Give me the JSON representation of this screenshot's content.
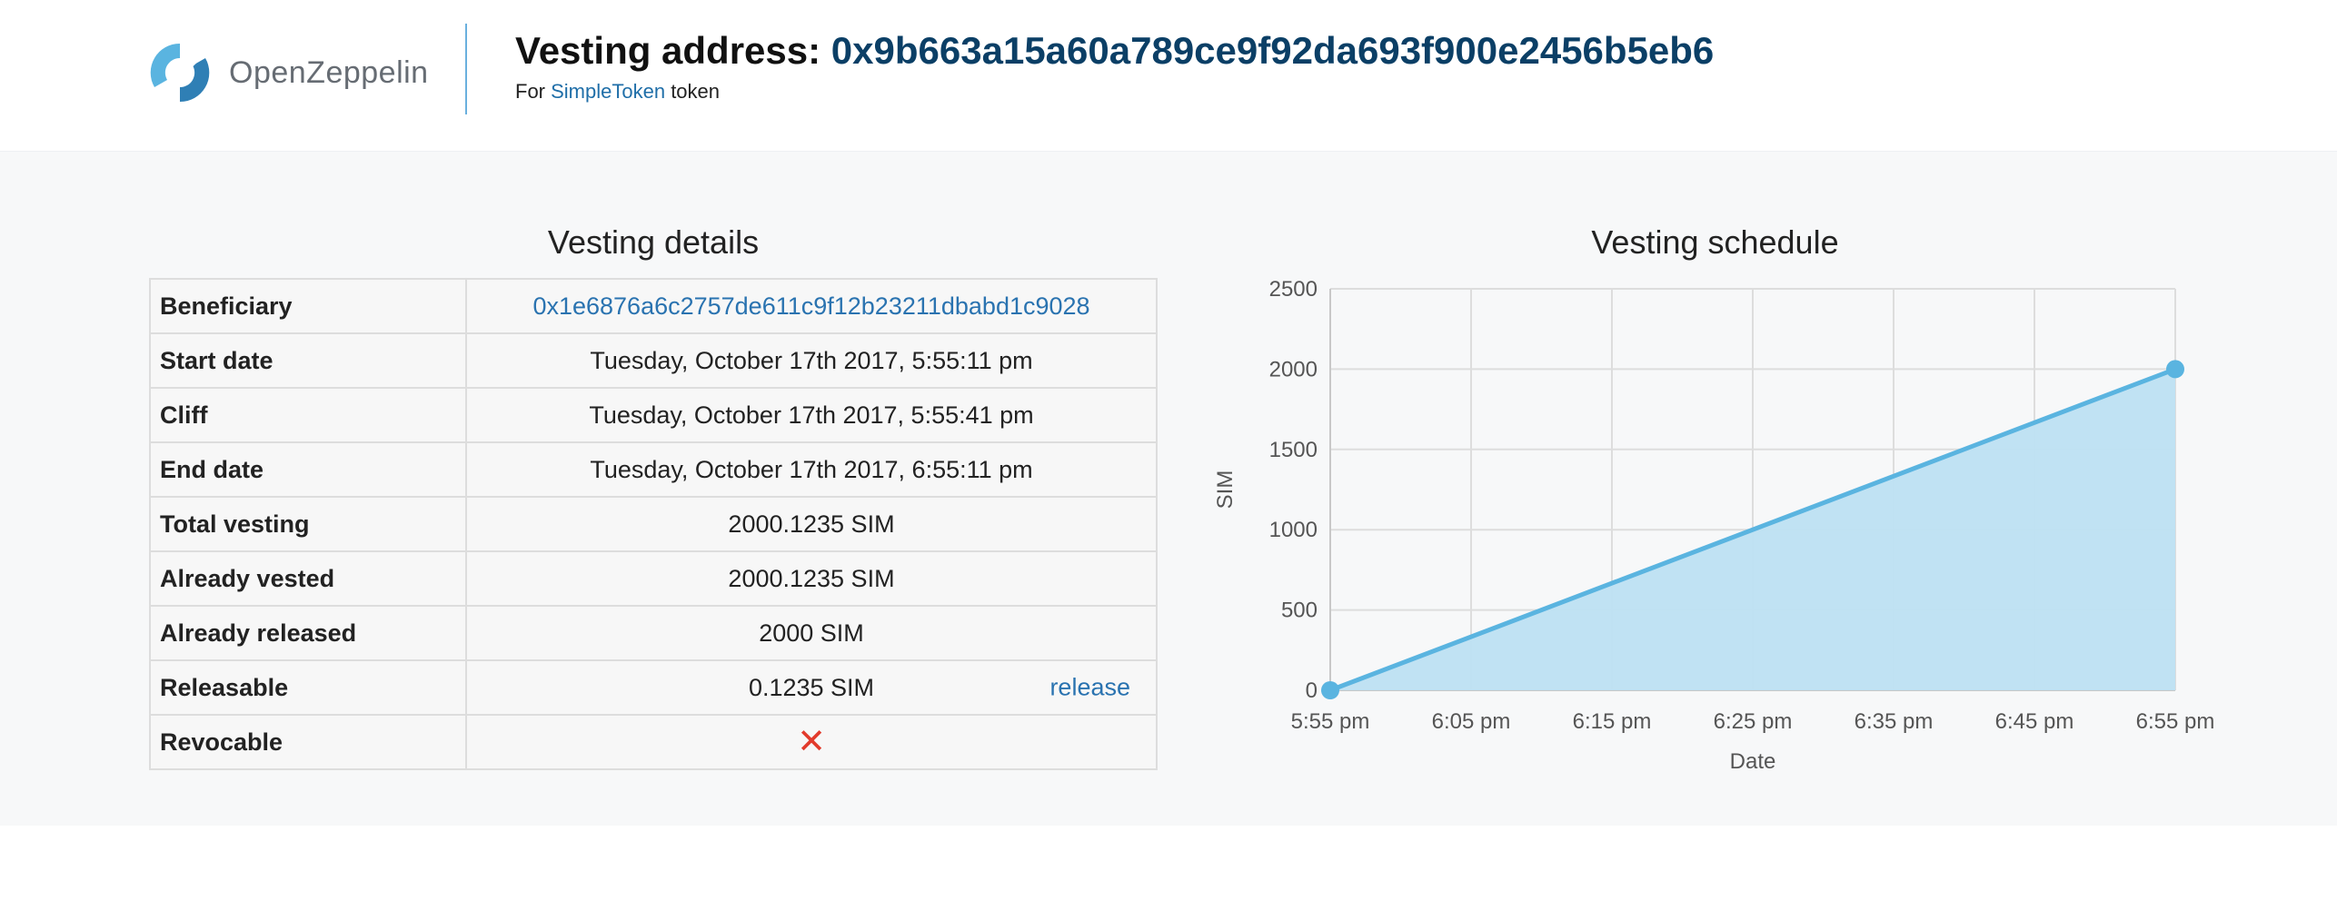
{
  "header": {
    "logo_text": "OpenZeppelin",
    "title_prefix": "Vesting address: ",
    "vesting_address": "0x9b663a15a60a789ce9f92da693f900e2456b5eb6",
    "subtitle_prefix": "For ",
    "token_name": "SimpleToken",
    "subtitle_suffix": " token"
  },
  "details": {
    "title": "Vesting details",
    "rows": [
      {
        "label": "Beneficiary",
        "value": "0x1e6876a6c2757de611c9f12b23211dbabd1c9028"
      },
      {
        "label": "Start date",
        "value": "Tuesday, October 17th 2017, 5:55:11 pm"
      },
      {
        "label": "Cliff",
        "value": "Tuesday, October 17th 2017, 5:55:41 pm"
      },
      {
        "label": "End date",
        "value": "Tuesday, October 17th 2017, 6:55:11 pm"
      },
      {
        "label": "Total vesting",
        "value": "2000.1235 SIM"
      },
      {
        "label": "Already vested",
        "value": "2000.1235 SIM"
      },
      {
        "label": "Already released",
        "value": "2000 SIM"
      },
      {
        "label": "Releasable",
        "value": "0.1235 SIM",
        "action": "release"
      },
      {
        "label": "Revocable",
        "value": "✕"
      }
    ]
  },
  "schedule": {
    "title": "Vesting schedule"
  },
  "colors": {
    "accent": "#5ab4e0",
    "fill": "#bde0f2",
    "link": "#2a73b0",
    "address": "#0b3f66",
    "revoke_no": "#e23b2c"
  },
  "chart_data": {
    "type": "area",
    "xlabel": "Date",
    "ylabel": "SIM",
    "x_ticks": [
      "5:55 pm",
      "6:05 pm",
      "6:15 pm",
      "6:25 pm",
      "6:35 pm",
      "6:45 pm",
      "6:55 pm"
    ],
    "y_ticks": [
      0,
      500,
      1000,
      1500,
      2000,
      2500
    ],
    "ylim": [
      0,
      2500
    ],
    "grid": true,
    "series": [
      {
        "points": [
          {
            "x": "5:55 pm",
            "y": 0
          },
          {
            "x": "6:55 pm",
            "y": 2000
          }
        ]
      }
    ]
  }
}
